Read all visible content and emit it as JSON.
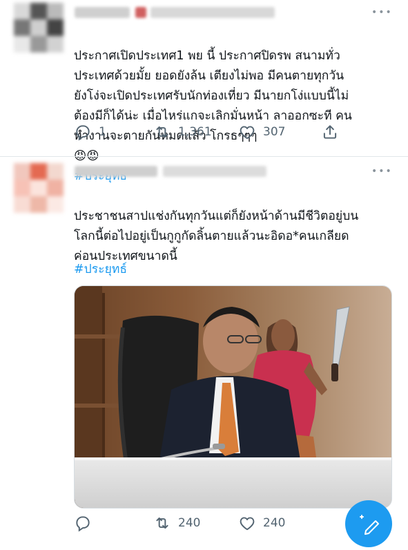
{
  "tweet1": {
    "text": "ประกาศเปิดประเทศ1 พย นี้ ประกาศปิดรพ สนามทั่ว\nประเทศด้วยมั้ย ยอดยังล้น เตียงไม่พอ มีคนตายทุกวัน\nยังโง่จะเปิดประเทศรับนักท่องเที่ยว มีนายกโง่แบบนี้ไม่\nต้องมีก็ได้น่ะ เมื่อไหร่แกจะเลิกมั่นหน้า ลาออกซะที คน\nทำงานจะตายกันหมดแล้ว โกรธๆๆๆ",
    "emoji": "😡😡",
    "hashtag": "#ประยุทธ์",
    "reply_count": "1",
    "retweet_count": "1,361",
    "like_count": "307"
  },
  "tweet2": {
    "text": "ประชาชนสาปแช่งกันทุกวันแต่ก็ยังหน้าด้านมีชีวิตอยู่บน\nโลกนี้ต่อไปอยู่เป็นกูกูกัดลิ้นตายแล้วนะอิดอ*คนเกลียด\nค่อนประเทศขนาดนี้",
    "hashtag": "#ประยุทธ์",
    "reply_count": "",
    "retweet_count": "240",
    "like_count": "240"
  },
  "icons": [
    "reply-icon",
    "retweet-icon",
    "like-icon",
    "share-icon",
    "more-icon",
    "compose-icon"
  ],
  "colors": {
    "accent": "#1d9bf0",
    "text": "#0f1419",
    "muted": "#536471"
  }
}
